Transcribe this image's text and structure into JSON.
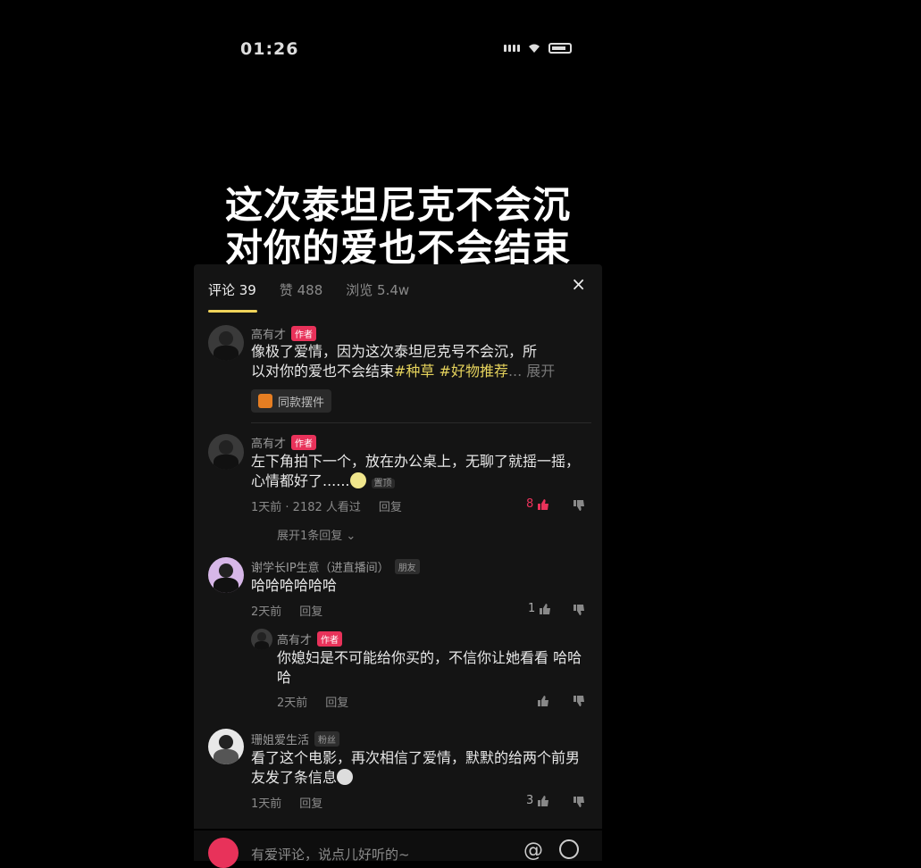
{
  "status": {
    "time": "01:26"
  },
  "caption": {
    "line1": "这次泰坦尼克不会沉",
    "line2": "对你的爱也不会结束"
  },
  "tabs": [
    {
      "label": "评论 39"
    },
    {
      "label": "赞 488"
    },
    {
      "label": "浏览 5.4w"
    }
  ],
  "close_label": "×",
  "comments": {
    "c1": {
      "name": "高有才",
      "badge": "作者",
      "line1": "像极了爱情，因为这次泰坦尼克号不会沉，所",
      "line2_text": "以对你的爱也不会结束",
      "hashtag1": "#种草",
      "hashtag2": "#好物推荐",
      "expand": "... 展开",
      "product_chip": "同款摆件"
    },
    "c2": {
      "name": "高有才",
      "badge": "作者",
      "line1": "左下角拍下一个，放在办公桌上，无聊了就摇一摇，",
      "line2": "心情都好了......",
      "pinned": "置顶",
      "time": "1天前 · 2182 人看过",
      "reply": "回复",
      "likes": "8",
      "expand_replies": "展开1条回复"
    },
    "c3": {
      "name": "谢学长IP生意（进直播间）",
      "badge": "朋友",
      "text": "哈哈哈哈哈哈",
      "time": "2天前",
      "reply": "回复",
      "likes": "1"
    },
    "c3_reply": {
      "name": "高有才",
      "badge": "作者",
      "line1": "你媳妇是不可能给你买的，不信你让她看看 哈哈",
      "line2": "哈",
      "time": "2天前",
      "reply": "回复"
    },
    "c4": {
      "name": "珊姐爱生活",
      "badge": "粉丝",
      "line1": "看了这个电影，再次相信了爱情，默默的给两个前男",
      "line2": "友发了条信息",
      "time": "1天前",
      "reply": "回复",
      "likes": "3"
    }
  },
  "input": {
    "placeholder": "有爱评论，说点儿好听的~",
    "at": "@"
  }
}
